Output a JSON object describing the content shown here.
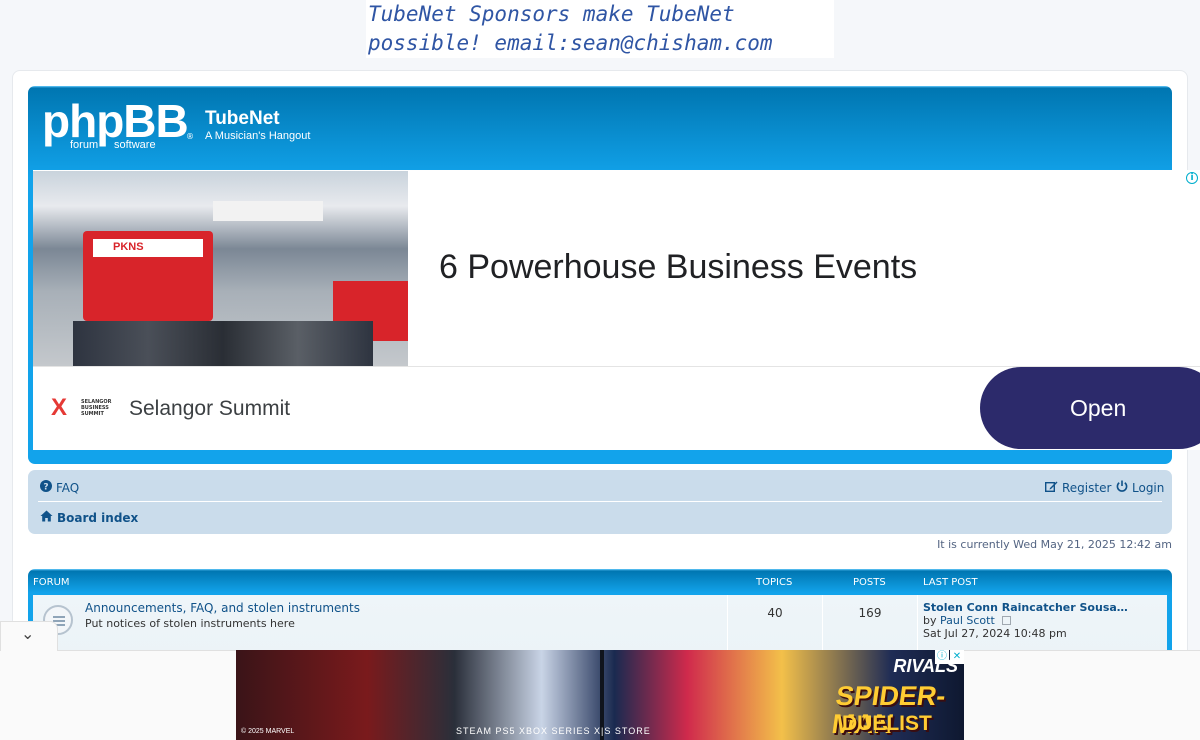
{
  "sponsor_banner": {
    "line1": "TubeNet Sponsors make TubeNet",
    "line2": "possible! email:sean@chisham.com"
  },
  "header": {
    "logo_text": "phpBB",
    "logo_sub1": "forum",
    "logo_sub2": "software",
    "logo_reg": "®",
    "site_title": "TubeNet",
    "site_description": "A Musician's Hangout"
  },
  "top_ad": {
    "headline": "6 Powerhouse Business Events",
    "advertiser": "Selangor Summit",
    "cta": "Open",
    "info_glyph": "i",
    "photo_booth_text": "PKNS",
    "logo_mark": "X",
    "logo_small_text": "SELANGOR BUSINESS SUMMIT"
  },
  "navbar": {
    "faq": "FAQ",
    "register": "Register",
    "login": "Login",
    "breadcrumb_home": "Board index",
    "icons": {
      "faq": "question-circle-icon",
      "register": "edit-icon",
      "login": "power-icon",
      "home": "home-icon"
    }
  },
  "current_time": "It is currently Wed May 21, 2025 12:42 am",
  "forum_table": {
    "headers": {
      "forum": "FORUM",
      "topics": "TOPICS",
      "posts": "POSTS",
      "last_post": "LAST POST"
    },
    "rows": [
      {
        "title": "Announcements, FAQ, and stolen instruments",
        "description": "Put notices of stolen instruments here",
        "topics": "40",
        "posts": "169",
        "last_post_title": "Stolen Conn Raincatcher Sousa…",
        "last_post_by_prefix": "by",
        "last_post_author": "Paul Scott",
        "last_post_date": "Sat Jul 27, 2024 10:48 pm"
      }
    ]
  },
  "bottom_ad": {
    "brand": "RIVALS",
    "title": "SPIDER-MAN",
    "subtitle": "DUELIST",
    "legal": "© 2025 MARVEL",
    "platforms": "STEAM   PS5       XBOX SERIES X|S   STORE",
    "collapse_glyph": "⌄",
    "info_glyph": "ⓘ",
    "close_glyph": "✕"
  }
}
